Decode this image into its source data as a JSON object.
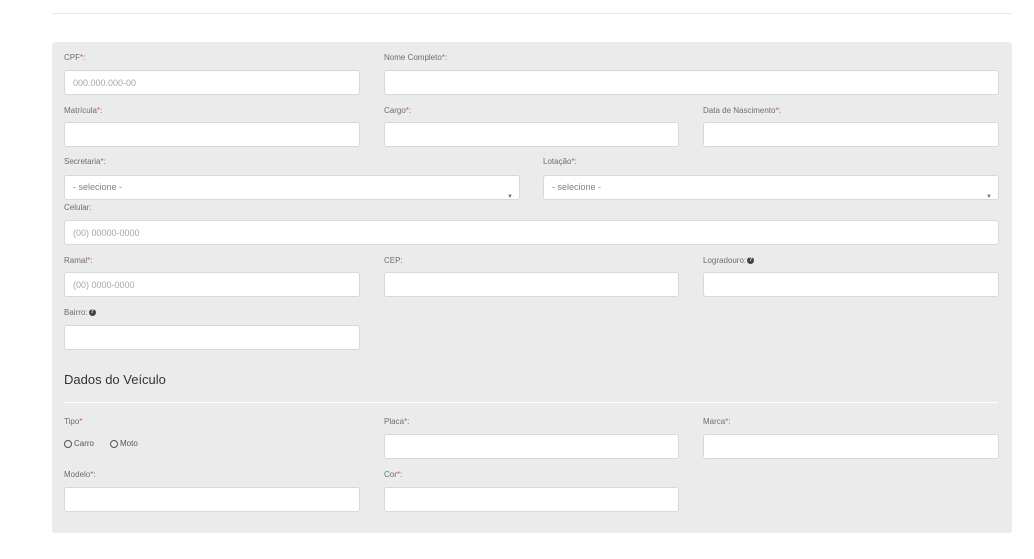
{
  "personal": {
    "cpf": {
      "label": "CPF",
      "required_mark": "*",
      "suffix": ":",
      "placeholder": "000.000.000-00"
    },
    "nome": {
      "label": "Nome Completo",
      "required_mark": "*",
      "suffix": ":",
      "placeholder": ""
    },
    "matricula": {
      "label": "Matrícula",
      "required_mark": "*",
      "suffix": ":",
      "placeholder": ""
    },
    "cargo": {
      "label": "Cargo",
      "required_mark": "*",
      "suffix": ":",
      "placeholder": ""
    },
    "nascimento": {
      "label": "Data de Nascimento",
      "required_mark": "*",
      "suffix": ":",
      "placeholder": ""
    },
    "secretaria": {
      "label": "Secretaria",
      "required_mark": "*",
      "suffix": ":",
      "selected": "- selecione -"
    },
    "lotacao": {
      "label": "Lotação",
      "required_mark": "*",
      "suffix": ":",
      "selected": "- selecione -"
    },
    "celular": {
      "label": "Celular",
      "suffix": ":",
      "placeholder": "(00) 00000-0000"
    },
    "ramal": {
      "label": "Ramal",
      "required_mark": "*",
      "suffix": ":",
      "placeholder": "(00) 0000-0000"
    },
    "cep": {
      "label": "CEP",
      "suffix": ":",
      "placeholder": ""
    },
    "logradouro": {
      "label": "Logradouro",
      "suffix": ":",
      "placeholder": ""
    },
    "bairro": {
      "label": "Bairro",
      "suffix": ":",
      "placeholder": ""
    }
  },
  "vehicle": {
    "section_title": "Dados do Veículo",
    "tipo": {
      "label": "Tipo",
      "required_mark": "*",
      "options": [
        "Carro",
        "Moto"
      ]
    },
    "placa": {
      "label": "Placa",
      "required_mark": "*",
      "suffix": ":",
      "placeholder": ""
    },
    "marca": {
      "label": "Marca",
      "required_mark": "*",
      "suffix": ":",
      "placeholder": ""
    },
    "modelo": {
      "label": "Modelo",
      "required_mark": "*",
      "suffix": ":",
      "placeholder": ""
    },
    "cor": {
      "label": "Cor",
      "required_mark": "*",
      "suffix": ":",
      "placeholder": ""
    }
  },
  "icons": {
    "help": "?",
    "caret": "▼"
  },
  "colors": {
    "required": "#d9534f",
    "panel": "#ebebeb"
  }
}
